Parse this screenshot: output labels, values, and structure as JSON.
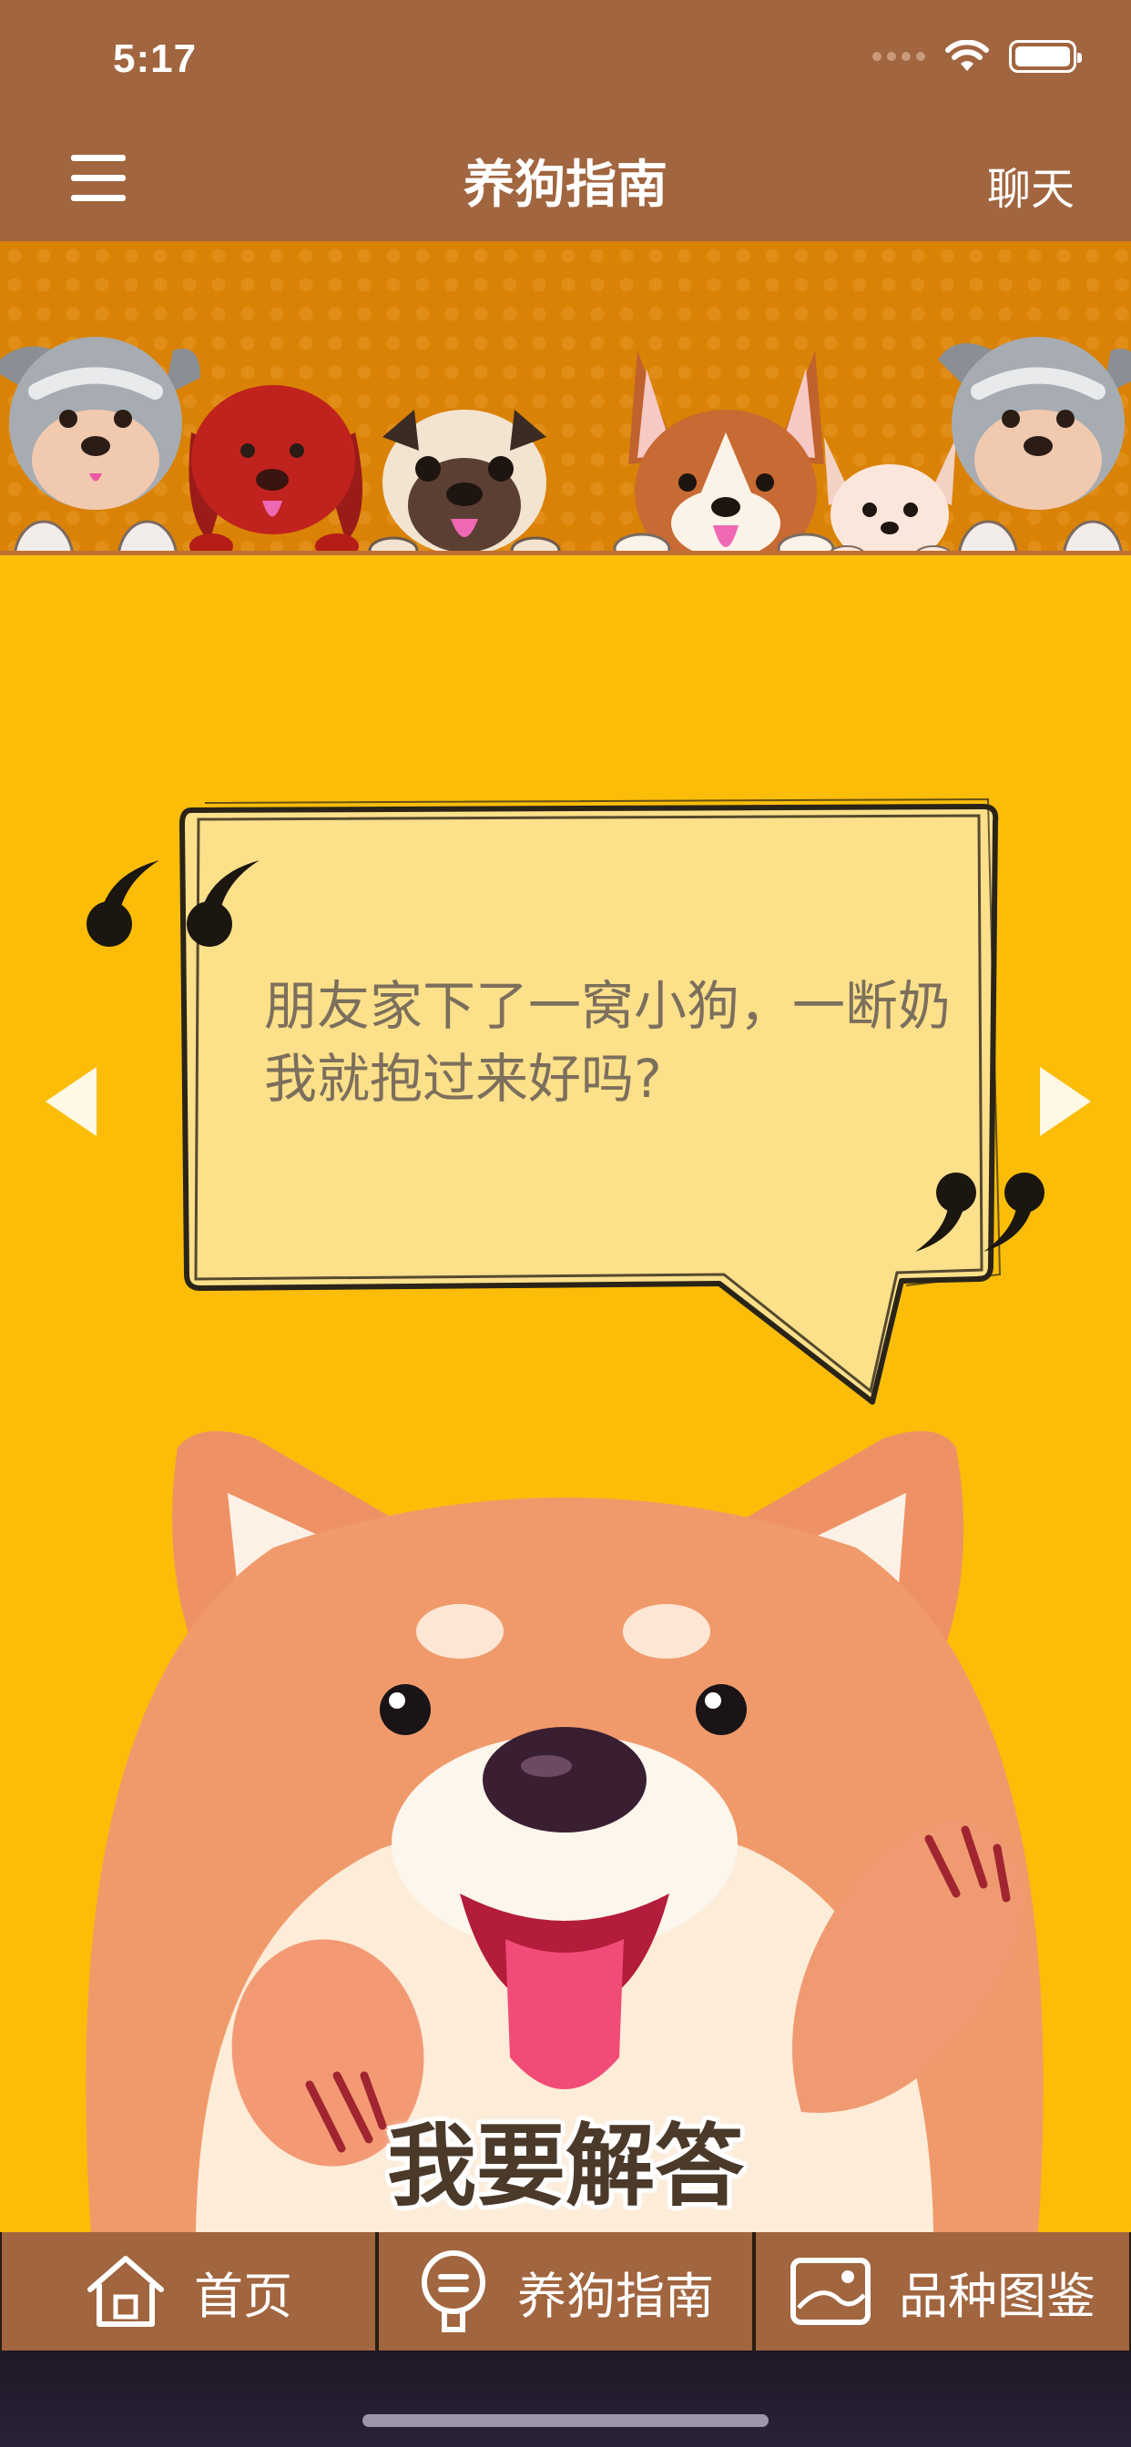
{
  "status_bar": {
    "time": "5:17"
  },
  "nav": {
    "title": "养狗指南",
    "chat_label": "聊天"
  },
  "question": {
    "text": "朋友家下了一窝小狗，一断奶我就抱过来好吗?"
  },
  "answer_button": {
    "label": "我要解答"
  },
  "tabs": [
    {
      "label": "首页",
      "icon": "home-icon"
    },
    {
      "label": "养狗指南",
      "icon": "guide-icon"
    },
    {
      "label": "品种图鉴",
      "icon": "gallery-icon"
    }
  ],
  "colors": {
    "nav_brown": "#a1653f",
    "page_yellow": "#fbbd08",
    "banner_orange": "#d98206",
    "bubble_fill": "#fde08a"
  }
}
